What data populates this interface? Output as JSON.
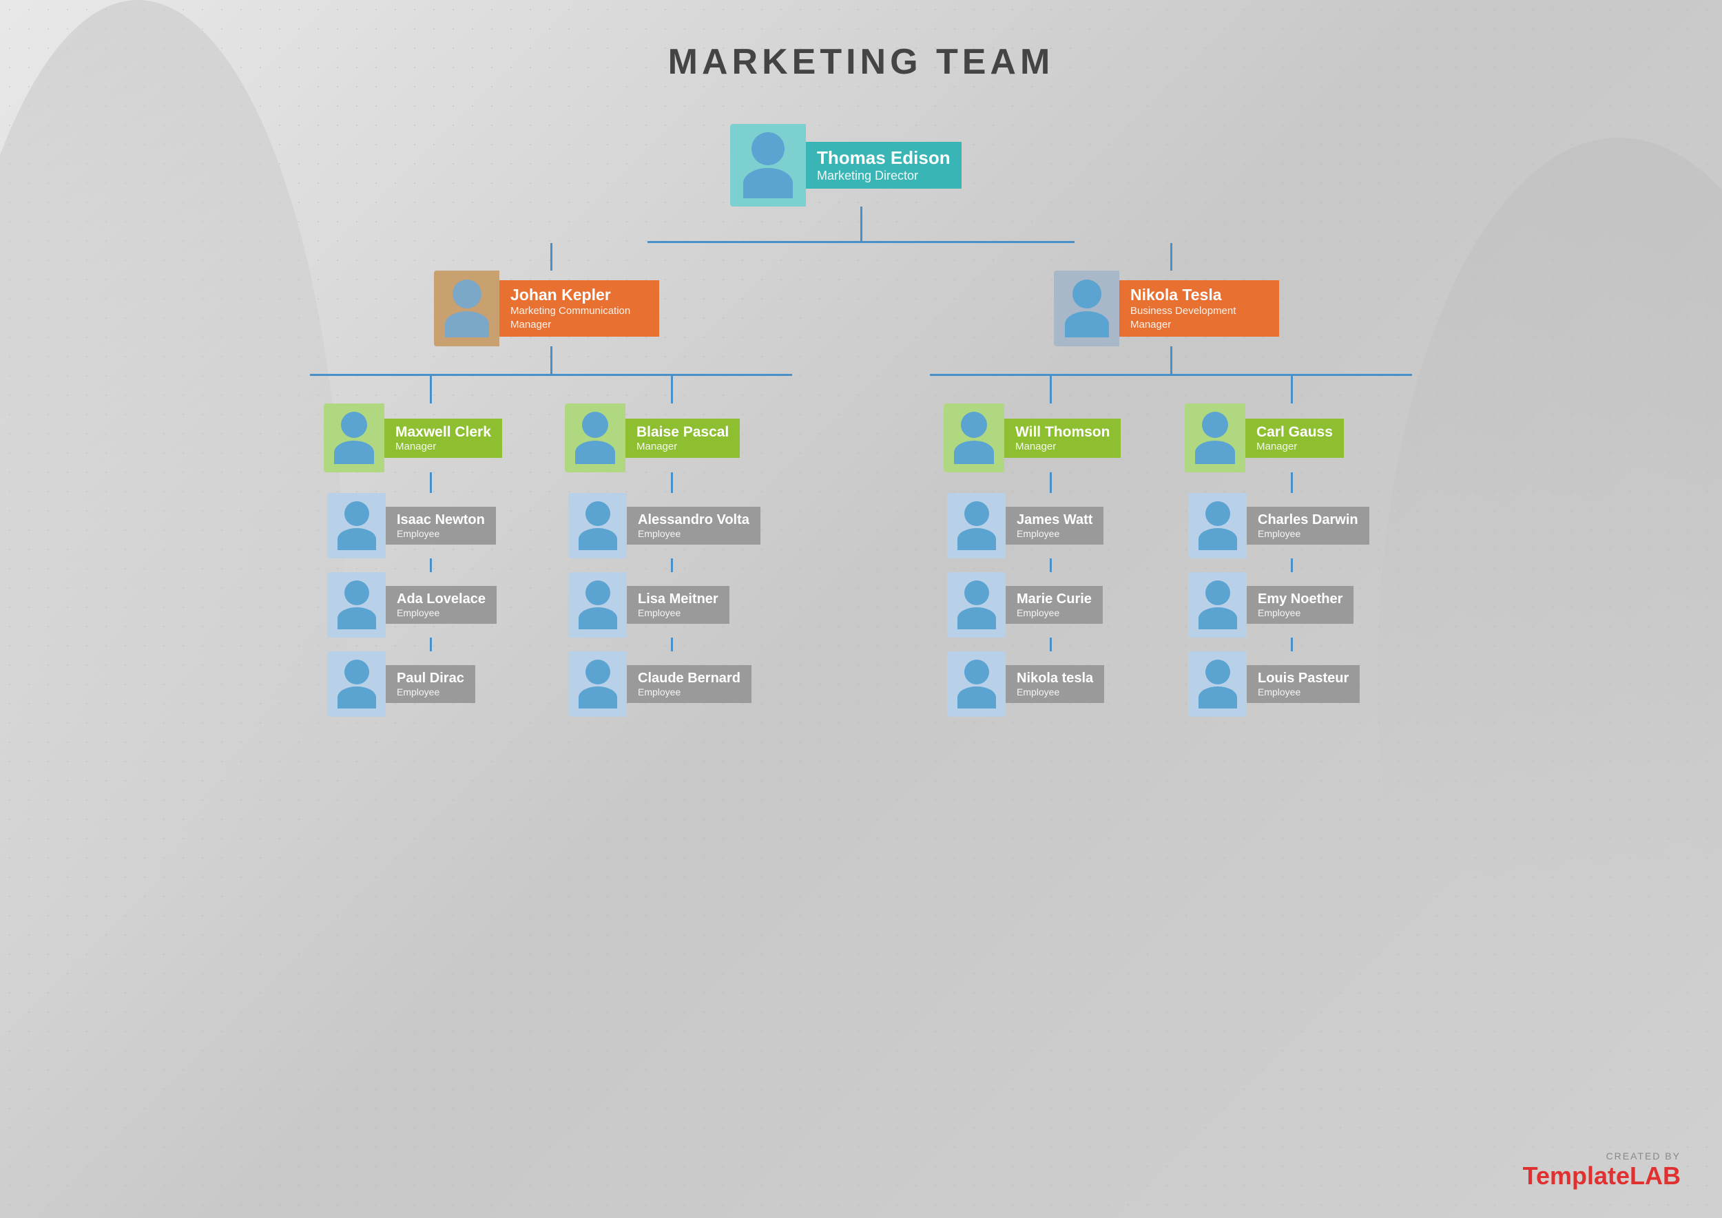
{
  "page": {
    "title": "MARKETING TEAM"
  },
  "nodes": {
    "director": {
      "name": "Thomas Edison",
      "role": "Marketing Director",
      "theme": "teal",
      "avatar_gender": "male"
    },
    "l1_left": {
      "name": "Johan Kepler",
      "role": "Marketing Communication Manager",
      "theme": "orange",
      "avatar_gender": "female"
    },
    "l1_right": {
      "name": "Nikola Tesla",
      "role": "Business Development Manager",
      "theme": "orange",
      "avatar_gender": "male"
    },
    "l2_1": {
      "name": "Maxwell Clerk",
      "role": "Manager",
      "theme": "green",
      "avatar_gender": "male"
    },
    "l2_2": {
      "name": "Blaise Pascal",
      "role": "Manager",
      "theme": "green",
      "avatar_gender": "male"
    },
    "l2_3": {
      "name": "Will Thomson",
      "role": "Manager",
      "theme": "green",
      "avatar_gender": "male"
    },
    "l2_4": {
      "name": "Carl Gauss",
      "role": "Manager",
      "theme": "green",
      "avatar_gender": "male"
    },
    "l3_1_1": {
      "name": "Isaac Newton",
      "role": "Employee",
      "theme": "gray",
      "avatar_gender": "male"
    },
    "l3_1_2": {
      "name": "Ada Lovelace",
      "role": "Employee",
      "theme": "gray",
      "avatar_gender": "female"
    },
    "l3_1_3": {
      "name": "Paul Dirac",
      "role": "Employee",
      "theme": "gray",
      "avatar_gender": "male"
    },
    "l3_2_1": {
      "name": "Alessandro Volta",
      "role": "Employee",
      "theme": "gray",
      "avatar_gender": "male"
    },
    "l3_2_2": {
      "name": "Lisa Meitner",
      "role": "Employee",
      "theme": "gray",
      "avatar_gender": "female"
    },
    "l3_2_3": {
      "name": "Claude Bernard",
      "role": "Employee",
      "theme": "gray",
      "avatar_gender": "male"
    },
    "l3_3_1": {
      "name": "James Watt",
      "role": "Employee",
      "theme": "gray",
      "avatar_gender": "male"
    },
    "l3_3_2": {
      "name": "Marie Curie",
      "role": "Employee",
      "theme": "gray",
      "avatar_gender": "female"
    },
    "l3_3_3": {
      "name": "Nikola tesla",
      "role": "Employee",
      "theme": "gray",
      "avatar_gender": "male"
    },
    "l3_4_1": {
      "name": "Charles Darwin",
      "role": "Employee",
      "theme": "gray",
      "avatar_gender": "male"
    },
    "l3_4_2": {
      "name": "Emy Noether",
      "role": "Employee",
      "theme": "gray",
      "avatar_gender": "female"
    },
    "l3_4_3": {
      "name": "Louis Pasteur",
      "role": "Employee",
      "theme": "gray",
      "avatar_gender": "male"
    }
  },
  "watermark": {
    "created_by": "CREATED BY",
    "brand_plain": "Template",
    "brand_colored": "LAB"
  },
  "colors": {
    "teal": "#3ab5b5",
    "orange": "#e87030",
    "green": "#8dbf30",
    "gray": "#9a9a9a",
    "connector": "#4a90c8"
  }
}
